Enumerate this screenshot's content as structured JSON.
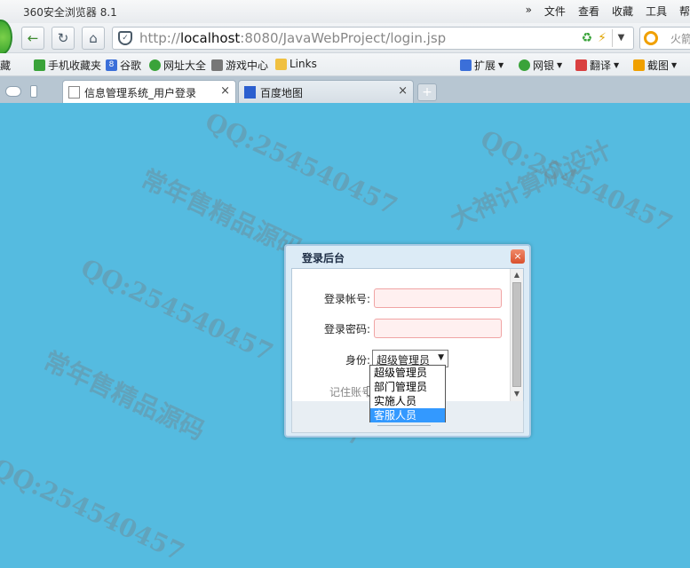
{
  "browser": {
    "app_title": "360安全浏览器 8.1",
    "menus": [
      "»",
      "文件",
      "查看",
      "收藏",
      "工具",
      "帮"
    ],
    "url_prefix": "http://",
    "url_host": "localhost",
    "url_rest": ":8080/JavaWebProject/login.jsp",
    "search_text": "火箭"
  },
  "bookmarks": [
    {
      "label": "藏",
      "icon": "favorites-icon",
      "color": "#f3b000"
    },
    {
      "label": "手机收藏夹",
      "icon": "phone-icon",
      "color": "#3aa33a"
    },
    {
      "label": "谷歌",
      "icon": "google-icon",
      "color": "#3b6fd9"
    },
    {
      "label": "网址大全",
      "icon": "navigation-icon",
      "color": "#3aa33a"
    },
    {
      "label": "游戏中心",
      "icon": "gamepad-icon",
      "color": "#555555"
    },
    {
      "label": "Links",
      "icon": "folder-icon",
      "color": "#f0c040"
    },
    {
      "label": "扩展",
      "icon": "extension-icon",
      "color": "#3b6fd9"
    },
    {
      "label": "网银",
      "icon": "bank-icon",
      "color": "#3aa33a"
    },
    {
      "label": "翻译",
      "icon": "translate-icon",
      "color": "#d94040"
    },
    {
      "label": "截图",
      "icon": "screenshot-icon",
      "color": "#f0a000"
    }
  ],
  "tabs": [
    {
      "label": "信息管理系统_用户登录",
      "active": true
    },
    {
      "label": "百度地图",
      "active": false
    }
  ],
  "tab_close_glyph": "×",
  "watermarks": [
    "常年售精品源码",
    "大神计算机设计",
    "QQ:254540457"
  ],
  "login": {
    "title": "登录后台",
    "close_glyph": "×",
    "account_label": "登录帐号:",
    "password_label": "登录密码:",
    "role_label": "身份:",
    "role_selected": "超级管理员",
    "role_options": [
      "超级管理员",
      "部门管理员",
      "实施人员",
      "客服人员"
    ],
    "role_highlighted_index": 3,
    "remember_label": "记住账号"
  }
}
